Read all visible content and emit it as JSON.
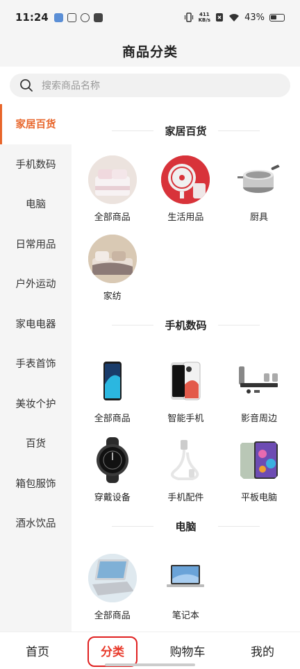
{
  "status_bar": {
    "time": "11:24",
    "net_speed_value": "411",
    "net_speed_unit": "KB/s",
    "battery": "43%"
  },
  "header": {
    "title": "商品分类"
  },
  "search": {
    "placeholder": "搜索商品名称"
  },
  "sidebar": {
    "items": [
      {
        "label": "家居百货",
        "active": true
      },
      {
        "label": "手机数码"
      },
      {
        "label": "电脑"
      },
      {
        "label": "日常用品"
      },
      {
        "label": "户外运动"
      },
      {
        "label": "家电电器"
      },
      {
        "label": "手表首饰"
      },
      {
        "label": "美妆个护"
      },
      {
        "label": "百货"
      },
      {
        "label": "箱包服饰"
      },
      {
        "label": "酒水饮品"
      }
    ]
  },
  "sections": [
    {
      "title": "家居百货",
      "items": [
        {
          "label": "全部商品",
          "icon": "bedding-image"
        },
        {
          "label": "生活用品",
          "icon": "fan-image"
        },
        {
          "label": "厨具",
          "icon": "cookware-image"
        },
        {
          "label": "家纺",
          "icon": "bed-image"
        }
      ]
    },
    {
      "title": "手机数码",
      "items": [
        {
          "label": "全部商品",
          "icon": "phone-image"
        },
        {
          "label": "智能手机",
          "icon": "smartphone-image"
        },
        {
          "label": "影音周边",
          "icon": "speaker-image"
        },
        {
          "label": "穿戴设备",
          "icon": "smartwatch-image"
        },
        {
          "label": "手机配件",
          "icon": "cable-image"
        },
        {
          "label": "平板电脑",
          "icon": "tablet-image"
        }
      ]
    },
    {
      "title": "电脑",
      "items": [
        {
          "label": "全部商品",
          "icon": "laptop-image"
        },
        {
          "label": "笔记本",
          "icon": "notebook-image"
        }
      ]
    }
  ],
  "tabbar": {
    "items": [
      {
        "label": "首页"
      },
      {
        "label": "分类",
        "active": true
      },
      {
        "label": "购物车"
      },
      {
        "label": "我的"
      }
    ]
  },
  "colors": {
    "accent": "#e8652a",
    "tab_active": "#e8392a"
  }
}
